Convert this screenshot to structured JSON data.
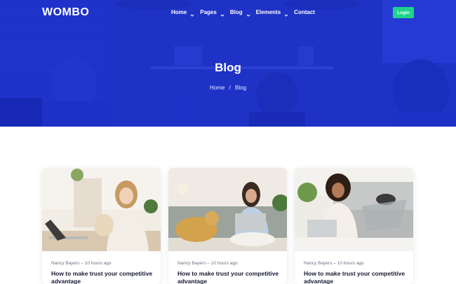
{
  "brand": {
    "logo_text": "WOMBO"
  },
  "nav": {
    "items": [
      {
        "label": "Home",
        "has_dropdown": true
      },
      {
        "label": "Pages",
        "has_dropdown": true
      },
      {
        "label": "Blog",
        "has_dropdown": true
      },
      {
        "label": "Elements",
        "has_dropdown": true
      },
      {
        "label": "Contact",
        "has_dropdown": false
      }
    ],
    "login_label": "Login"
  },
  "hero": {
    "title": "Blog",
    "breadcrumb": {
      "home": "Home",
      "separator": "/",
      "current": "Blog"
    }
  },
  "posts": [
    {
      "author": "Nancy Bayers",
      "time": "10 hours ago",
      "meta_sep": "–",
      "title": "How to make trust your competitive advantage"
    },
    {
      "author": "Nancy Bayers",
      "time": "10 hours ago",
      "meta_sep": "–",
      "title": "How to make trust your competitive advantage"
    },
    {
      "author": "Nancy Bayers",
      "time": "10 hours ago",
      "meta_sep": "–",
      "title": "How to make trust your competitive advantage"
    }
  ],
  "colors": {
    "hero_overlay": "#1f36c8",
    "login_button": "#1fd38a",
    "title_text": "#161a33"
  }
}
